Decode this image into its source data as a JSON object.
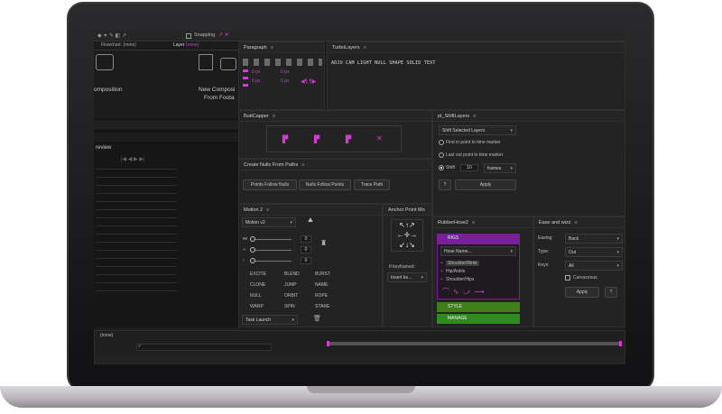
{
  "toolbar": {
    "snapping_label": "Snapping"
  },
  "left_tabs": {
    "flowchart": "Flowchart: (none)",
    "layer": "Layer",
    "layer_value": "(none)"
  },
  "left_tiles": {
    "comp": "omposition",
    "footage_1": "New Composi",
    "footage_2": "From Foota"
  },
  "preview": {
    "title": "review"
  },
  "paragraph": {
    "title": "Paragraph",
    "indent_values": [
      "0 px",
      "0 px",
      "0 px",
      "0 px"
    ]
  },
  "turbolayers": {
    "title": "TurboLayers",
    "items": "ADJU CAM LIGHT NULL SHAPE SOLID TEXT"
  },
  "buttcapper": {
    "title": "ButtCapper"
  },
  "pt_shiftlayers": {
    "title": "pt_ShiftLayers",
    "dropdown": "Shift Selected Layers",
    "opt1": "First in point to time marker",
    "opt2": "Last out point to time marker",
    "shift_label": "Shift",
    "shift_value": "10",
    "unit": "frames",
    "help": "?",
    "apply": "Apply"
  },
  "nulls_from_paths": {
    "title": "Create Nulls From Paths",
    "btn1": "Points Follow Nulls",
    "btn2": "Nulls Follow Points",
    "btn3": "Trace Path"
  },
  "motion2": {
    "title": "Motion 2",
    "version": "Motion v2",
    "values": [
      "0",
      "0",
      "0"
    ],
    "buttons": [
      "EXCITE",
      "BLEND",
      "BURST",
      "CLONE",
      "JUMP",
      "NAME",
      "NULL",
      "ORBIT",
      "ROPE",
      "WARP",
      "SPIN",
      "STARE"
    ],
    "task": "Task Launch"
  },
  "anchor": {
    "title": "Anchor Point Mo",
    "keyframed_label": "If keyframed:",
    "keyframed_value": "Insert ke..."
  },
  "rubberhose": {
    "title": "RubberHose2",
    "tab_rig": "RIGS",
    "hose_name": "Hose Name...",
    "presets": [
      "Shoulder/Wrist",
      "Hip/Ankle",
      "Shoulder/Hips"
    ],
    "style": "STYLE",
    "manage": "MANAGE"
  },
  "ease": {
    "title": "Ease and wizz",
    "easing_label": "Easing:",
    "easing_value": "Back",
    "type_label": "Type:",
    "type_value": "Out",
    "keys_label": "Keys:",
    "keys_value": "All",
    "curvaceous": "Curvaceous",
    "apply": "Apply",
    "help": "?"
  },
  "timeline": {
    "comp": "(none)",
    "search_placeholder": ""
  },
  "colors": {
    "accent": "#d63ad6",
    "rh_rig": "#7a1f9a",
    "rh_style": "#3e7f1a",
    "rh_manage": "#2f8a1f"
  }
}
